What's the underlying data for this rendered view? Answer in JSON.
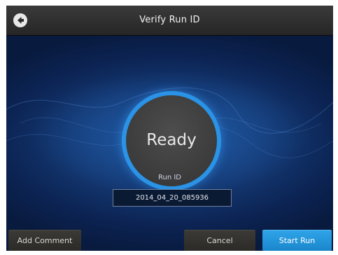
{
  "header": {
    "title": "Verify Run ID",
    "back_icon": "arrow-left-circle-icon"
  },
  "status": {
    "text": "Ready"
  },
  "run": {
    "label": "Run ID",
    "value": "2014_04_20_085936"
  },
  "footer": {
    "add_comment_label": "Add Comment",
    "cancel_label": "Cancel",
    "start_run_label": "Start Run"
  },
  "colors": {
    "accent": "#2a93e6",
    "primary_button": "#1e8fd6",
    "background": "#0d2146"
  }
}
